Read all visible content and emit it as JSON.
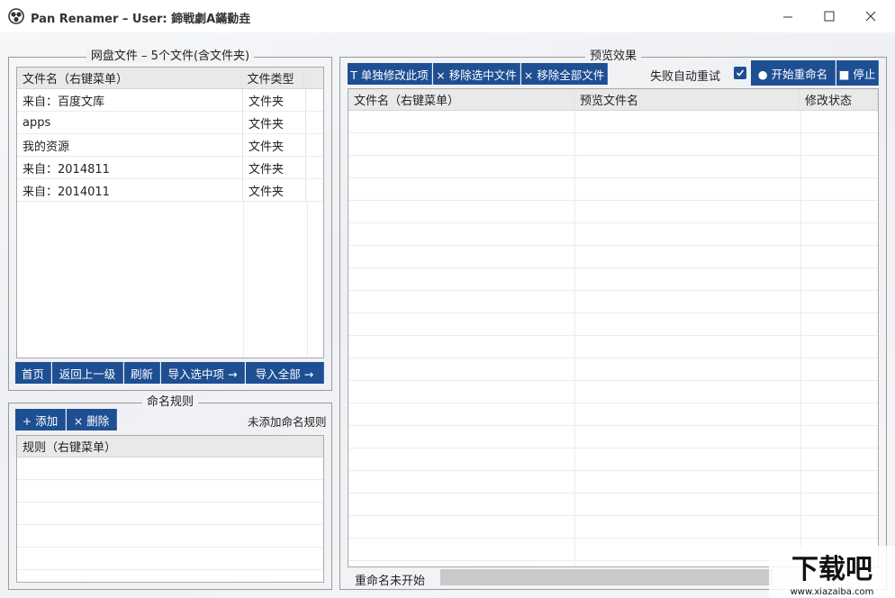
{
  "window": {
    "title": "Pan Renamer – User:  鍗戦劇A鏋勬垚"
  },
  "left_files": {
    "legend": "网盘文件 – 5个文件(含文件夹)",
    "columns": [
      "文件名（右键菜单）",
      "文件类型"
    ],
    "rows": [
      {
        "name": "来自：百度文库",
        "type": "文件夹"
      },
      {
        "name": "apps",
        "type": "文件夹"
      },
      {
        "name": "我的资源",
        "type": "文件夹"
      },
      {
        "name": "来自：2014811",
        "type": "文件夹"
      },
      {
        "name": "来自：2014011",
        "type": "文件夹"
      }
    ],
    "buttons": {
      "home": "首页",
      "up": "返回上一级",
      "refresh": "刷新",
      "import_selected": "导入选中项 →",
      "import_all": "导入全部 →"
    }
  },
  "rules": {
    "legend": "命名规则",
    "add": "+ 添加",
    "delete": "× 删除",
    "status": "未添加命名规则",
    "column": "规则（右键菜单）"
  },
  "preview": {
    "legend": "预览效果",
    "buttons": {
      "edit_single": "T 单独修改此项",
      "remove_selected": "× 移除选中文件",
      "remove_all": "× 移除全部文件",
      "start": "● 开始重命名",
      "stop": "■ 停止"
    },
    "retry_label": "失败自动重试",
    "retry_checked": true,
    "columns": [
      "文件名（右键菜单）",
      "预览文件名",
      "修改状态"
    ],
    "status_text": "重命名未开始",
    "progress": 0
  },
  "colors": {
    "accent": "#1e4f93"
  },
  "watermark": {
    "text": "下载吧",
    "url": "www.xiazaiba.com"
  }
}
